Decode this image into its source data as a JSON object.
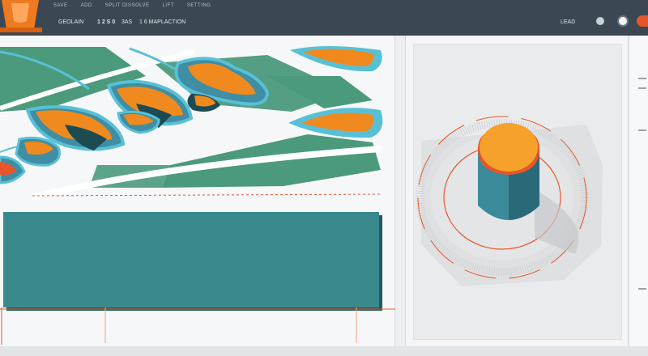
{
  "header": {
    "menu": [
      "SAVE",
      "ADD",
      "SPLIT DISSOLVE",
      "LIFT",
      "SETTING"
    ],
    "tools": {
      "primary": "GEOLAIN",
      "code": "1 2 S 0",
      "mode": "3AS",
      "action": "1 6 MAPLACTION"
    },
    "right_label": "LEAD"
  },
  "icons": {
    "logo": "traffic-cone-icon",
    "right_a": "circle-icon",
    "right_b": "color-swatch-icon"
  },
  "colors": {
    "topbar": "#3b4753",
    "accent": "#f08a1e",
    "teal": "#3a8a8d",
    "cyan": "#58c0d6",
    "green": "#4b9a7c"
  }
}
